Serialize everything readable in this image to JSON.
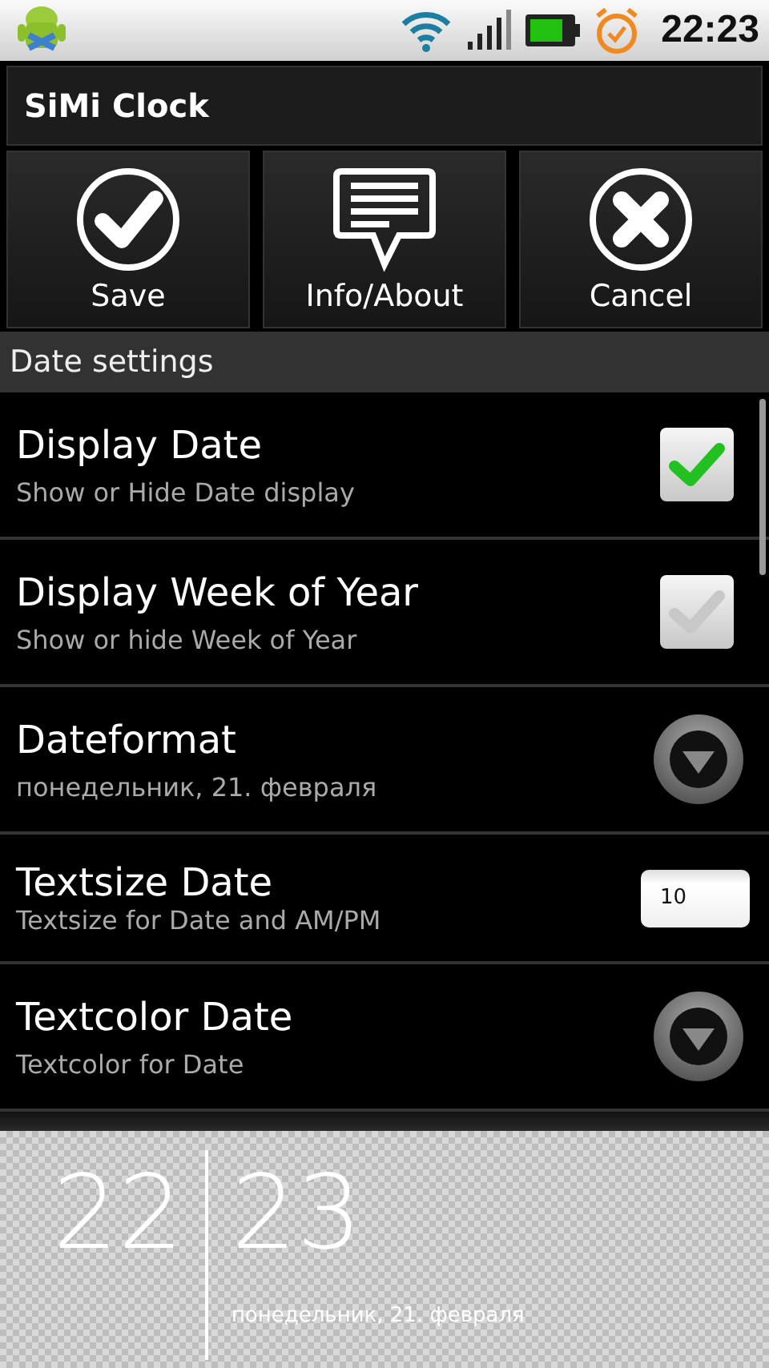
{
  "status_bar": {
    "time": "22:23"
  },
  "title": "SiMi Clock",
  "actions": [
    {
      "kind": "save",
      "label": "Save"
    },
    {
      "kind": "info",
      "label": "Info/About"
    },
    {
      "kind": "cancel",
      "label": "Cancel"
    }
  ],
  "section": "Date settings",
  "preferences": [
    {
      "kind": "checkbox",
      "title": "Display Date",
      "summary": "Show or Hide Date display",
      "checked": true
    },
    {
      "kind": "checkbox",
      "title": "Display Week of Year",
      "summary": "Show or hide Week of Year",
      "checked": false
    },
    {
      "kind": "list",
      "title": "Dateformat",
      "summary": "понедельник, 21. февраля"
    },
    {
      "kind": "number",
      "title": "Textsize Date",
      "summary": "Textsize for Date and AM/PM",
      "value": "10"
    },
    {
      "kind": "list",
      "title": "Textcolor Date",
      "summary": "Textcolor for Date"
    }
  ],
  "preview": {
    "hours": "22",
    "minutes": "23",
    "date": "понедельник, 21. февраля"
  }
}
